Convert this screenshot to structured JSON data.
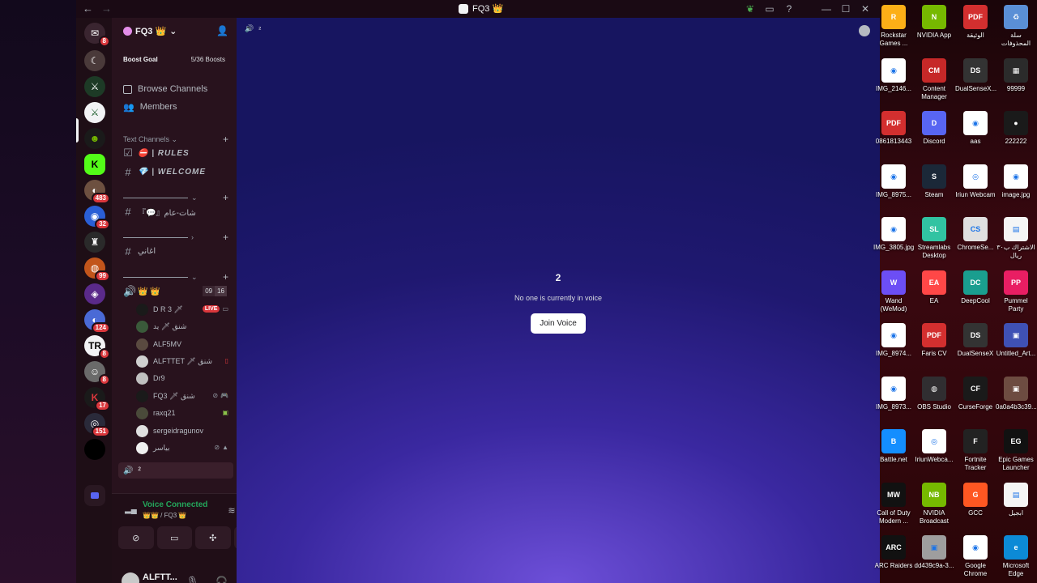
{
  "window": {
    "title": "FQ3 👑",
    "nav_back": "←",
    "nav_forward": "→",
    "controls": {
      "minimize": "—",
      "maximize": "☐",
      "close": "✕"
    }
  },
  "server_rail": {
    "badges": [
      "8",
      "483",
      "32",
      "99",
      "124",
      "8",
      "8",
      "17",
      "151"
    ]
  },
  "guild": {
    "name": "FQ3 👑",
    "boost_goal_label": "Boost Goal",
    "boost_progress": "5/36 Boosts",
    "browse_channels": "Browse Channels",
    "members": "Members"
  },
  "categories": {
    "text_channels": "Text Channels"
  },
  "channels": {
    "rules": "⛔ | RULES",
    "welcome": "💎 | WELCOME",
    "general_chat": "『💬』شات-عام",
    "songs": "اغاني",
    "voice_main": "👑 👑",
    "voice_main_count_a": "09",
    "voice_main_count_b": "16",
    "active_voice": "²"
  },
  "members": [
    {
      "name": "D R 3 🗡",
      "live": "LIVE"
    },
    {
      "name": "شنق 🗡 يد"
    },
    {
      "name": "ALF5MV"
    },
    {
      "name": "ALFTTET 🗡 شنق"
    },
    {
      "name": "Dr9"
    },
    {
      "name": "FQ3 🗡 شنق"
    },
    {
      "name": "raxq21"
    },
    {
      "name": "sergeidragunov"
    },
    {
      "name": "بياسر"
    }
  ],
  "voice_panel": {
    "status": "Voice Connected",
    "location": "👑👑 / FQ3 👑"
  },
  "user_panel": {
    "name": "ALFTT...",
    "sub": "🔇 ▫ 📱 ^"
  },
  "stage": {
    "channel_label": "²",
    "title": "2",
    "subtitle": "No one is currently in voice",
    "join_button": "Join Voice"
  },
  "desktop_icons": [
    {
      "label": "Rockstar Games ...",
      "color": "#fcaf17",
      "glyph": "R"
    },
    {
      "label": "NVIDIA App",
      "color": "#76b900",
      "glyph": "N"
    },
    {
      "label": "الوثيقة",
      "color": "#d32f2f",
      "glyph": "PDF"
    },
    {
      "label": "سلة المحذوفات",
      "color": "#5a8fd6",
      "glyph": "♻"
    },
    {
      "label": "IMG_2146...",
      "color": "#ffffff",
      "glyph": "◉"
    },
    {
      "label": "Content Manager",
      "color": "#c62828",
      "glyph": "CM"
    },
    {
      "label": "DualSenseX...",
      "color": "#333333",
      "glyph": "DS"
    },
    {
      "label": "99999",
      "color": "#2b2b2b",
      "glyph": "▦"
    },
    {
      "label": "0861813443",
      "color": "#d32f2f",
      "glyph": "PDF"
    },
    {
      "label": "Discord",
      "color": "#5865f2",
      "glyph": "D"
    },
    {
      "label": "aas",
      "color": "#ffffff",
      "glyph": "◉"
    },
    {
      "label": "222222",
      "color": "#1a1a1a",
      "glyph": "●"
    },
    {
      "label": "IMG_8975...",
      "color": "#ffffff",
      "glyph": "◉"
    },
    {
      "label": "Steam",
      "color": "#1b2838",
      "glyph": "S"
    },
    {
      "label": "Iriun Webcam",
      "color": "#ffffff",
      "glyph": "◎"
    },
    {
      "label": "image.jpg",
      "color": "#ffffff",
      "glyph": "◉"
    },
    {
      "label": "IMG_3805.jpg",
      "color": "#ffffff",
      "glyph": "◉"
    },
    {
      "label": "Streamlabs Desktop",
      "color": "#31c3a2",
      "glyph": "SL"
    },
    {
      "label": "ChromeSe...",
      "color": "#e0e0e0",
      "glyph": "CS"
    },
    {
      "label": "الاشتراك ب٣٠ ريال",
      "color": "#f5f5f5",
      "glyph": "▤"
    },
    {
      "label": "Wand (WeMod)",
      "color": "#6c4ef5",
      "glyph": "W"
    },
    {
      "label": "EA",
      "color": "#ff4747",
      "glyph": "EA"
    },
    {
      "label": "DeepCool",
      "color": "#1a9e8f",
      "glyph": "DC"
    },
    {
      "label": "Pummel Party",
      "color": "#e91e63",
      "glyph": "PP"
    },
    {
      "label": "IMG_8974...",
      "color": "#ffffff",
      "glyph": "◉"
    },
    {
      "label": "Faris CV",
      "color": "#d32f2f",
      "glyph": "PDF"
    },
    {
      "label": "DualSenseX",
      "color": "#333333",
      "glyph": "DS"
    },
    {
      "label": "Untitled_Art...",
      "color": "#3f51b5",
      "glyph": "▣"
    },
    {
      "label": "IMG_8973...",
      "color": "#ffffff",
      "glyph": "◉"
    },
    {
      "label": "OBS Studio",
      "color": "#302e31",
      "glyph": "◍"
    },
    {
      "label": "CurseForge",
      "color": "#1a1a1a",
      "glyph": "CF"
    },
    {
      "label": "0a0a4b3c39...",
      "color": "#6d4c41",
      "glyph": "▣"
    },
    {
      "label": "Battle.net",
      "color": "#148eff",
      "glyph": "B"
    },
    {
      "label": "IriunWebca...",
      "color": "#ffffff",
      "glyph": "◎"
    },
    {
      "label": "Fortnite Tracker",
      "color": "#222222",
      "glyph": "F"
    },
    {
      "label": "Epic Games Launcher",
      "color": "#111111",
      "glyph": "EG"
    },
    {
      "label": "Call of Duty Modern ...",
      "color": "#111111",
      "glyph": "MW"
    },
    {
      "label": "NVIDIA Broadcast",
      "color": "#76b900",
      "glyph": "NB"
    },
    {
      "label": "GCC",
      "color": "#ff5722",
      "glyph": "G"
    },
    {
      "label": "ابجيل",
      "color": "#f5f5f5",
      "glyph": "▤"
    },
    {
      "label": "ARC Raiders",
      "color": "#111111",
      "glyph": "ARC"
    },
    {
      "label": "dd439c9a-3...",
      "color": "#9e9e9e",
      "glyph": "▣"
    },
    {
      "label": "Google Chrome",
      "color": "#ffffff",
      "glyph": "◉"
    },
    {
      "label": "Microsoft Edge",
      "color": "#0c8ad6",
      "glyph": "e"
    }
  ],
  "colors": {
    "discord_bg": "#28121d",
    "rail_bg": "#1e0e16",
    "stage_accent": "#6d4fd8",
    "badge_red": "#da373c",
    "join_bg": "#ffffff"
  }
}
